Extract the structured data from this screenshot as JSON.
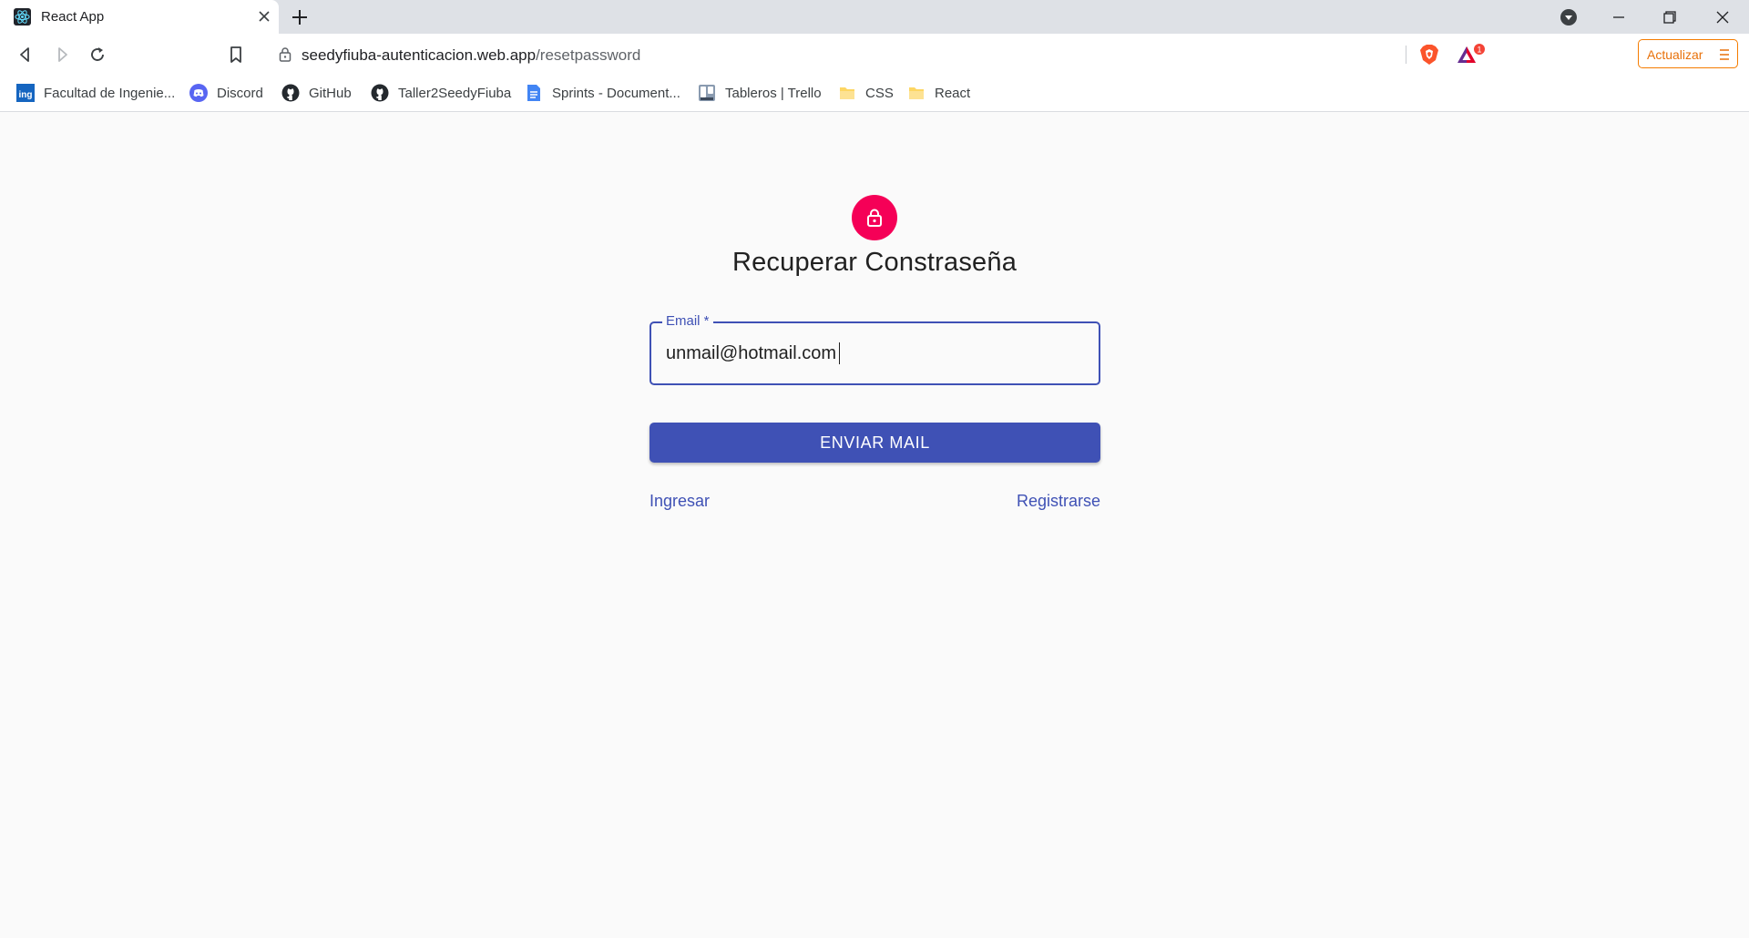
{
  "browser": {
    "tab_title": "React App",
    "url_host": "seedyfiuba-autenticacion.web.app",
    "url_path": "/resetpassword",
    "update_button_label": "Actualizar",
    "rewards_badge": "1",
    "accent": "#e8710a"
  },
  "bookmarks": [
    {
      "label": "Facultad de Ingenie...",
      "icon": "fiuba-icon"
    },
    {
      "label": "Discord",
      "icon": "discord-icon"
    },
    {
      "label": "GitHub",
      "icon": "github-icon"
    },
    {
      "label": "Taller2SeedyFiuba",
      "icon": "github-icon"
    },
    {
      "label": "Sprints - Document...",
      "icon": "google-docs-icon"
    },
    {
      "label": "Tableros | Trello",
      "icon": "trello-icon"
    },
    {
      "label": "CSS",
      "icon": "folder-icon"
    },
    {
      "label": "React",
      "icon": "folder-icon"
    }
  ],
  "page": {
    "title": "Recuperar Constraseña",
    "avatar_icon": "lock-icon",
    "avatar_color": "#f50057",
    "primary_color": "#3f51b5",
    "email_label": "Email *",
    "email_value": "unmail@hotmail.com",
    "submit_label": "ENVIAR MAIL",
    "login_link": "Ingresar",
    "register_link": "Registrarse"
  }
}
